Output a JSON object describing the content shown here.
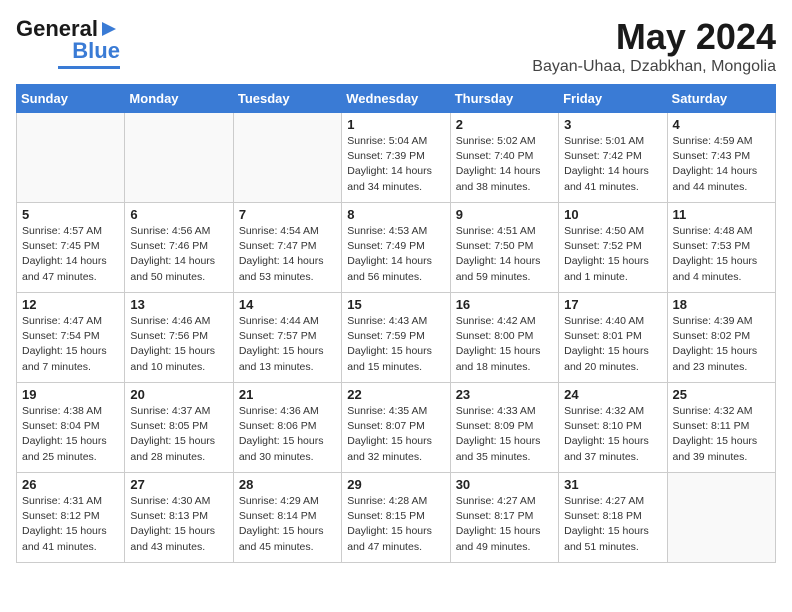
{
  "header": {
    "logo_general": "General",
    "logo_blue": "Blue",
    "month": "May 2024",
    "location": "Bayan-Uhaa, Dzabkhan, Mongolia"
  },
  "days_of_week": [
    "Sunday",
    "Monday",
    "Tuesday",
    "Wednesday",
    "Thursday",
    "Friday",
    "Saturday"
  ],
  "weeks": [
    [
      {
        "day": "",
        "info": ""
      },
      {
        "day": "",
        "info": ""
      },
      {
        "day": "",
        "info": ""
      },
      {
        "day": "1",
        "info": "Sunrise: 5:04 AM\nSunset: 7:39 PM\nDaylight: 14 hours\nand 34 minutes."
      },
      {
        "day": "2",
        "info": "Sunrise: 5:02 AM\nSunset: 7:40 PM\nDaylight: 14 hours\nand 38 minutes."
      },
      {
        "day": "3",
        "info": "Sunrise: 5:01 AM\nSunset: 7:42 PM\nDaylight: 14 hours\nand 41 minutes."
      },
      {
        "day": "4",
        "info": "Sunrise: 4:59 AM\nSunset: 7:43 PM\nDaylight: 14 hours\nand 44 minutes."
      }
    ],
    [
      {
        "day": "5",
        "info": "Sunrise: 4:57 AM\nSunset: 7:45 PM\nDaylight: 14 hours\nand 47 minutes."
      },
      {
        "day": "6",
        "info": "Sunrise: 4:56 AM\nSunset: 7:46 PM\nDaylight: 14 hours\nand 50 minutes."
      },
      {
        "day": "7",
        "info": "Sunrise: 4:54 AM\nSunset: 7:47 PM\nDaylight: 14 hours\nand 53 minutes."
      },
      {
        "day": "8",
        "info": "Sunrise: 4:53 AM\nSunset: 7:49 PM\nDaylight: 14 hours\nand 56 minutes."
      },
      {
        "day": "9",
        "info": "Sunrise: 4:51 AM\nSunset: 7:50 PM\nDaylight: 14 hours\nand 59 minutes."
      },
      {
        "day": "10",
        "info": "Sunrise: 4:50 AM\nSunset: 7:52 PM\nDaylight: 15 hours\nand 1 minute."
      },
      {
        "day": "11",
        "info": "Sunrise: 4:48 AM\nSunset: 7:53 PM\nDaylight: 15 hours\nand 4 minutes."
      }
    ],
    [
      {
        "day": "12",
        "info": "Sunrise: 4:47 AM\nSunset: 7:54 PM\nDaylight: 15 hours\nand 7 minutes."
      },
      {
        "day": "13",
        "info": "Sunrise: 4:46 AM\nSunset: 7:56 PM\nDaylight: 15 hours\nand 10 minutes."
      },
      {
        "day": "14",
        "info": "Sunrise: 4:44 AM\nSunset: 7:57 PM\nDaylight: 15 hours\nand 13 minutes."
      },
      {
        "day": "15",
        "info": "Sunrise: 4:43 AM\nSunset: 7:59 PM\nDaylight: 15 hours\nand 15 minutes."
      },
      {
        "day": "16",
        "info": "Sunrise: 4:42 AM\nSunset: 8:00 PM\nDaylight: 15 hours\nand 18 minutes."
      },
      {
        "day": "17",
        "info": "Sunrise: 4:40 AM\nSunset: 8:01 PM\nDaylight: 15 hours\nand 20 minutes."
      },
      {
        "day": "18",
        "info": "Sunrise: 4:39 AM\nSunset: 8:02 PM\nDaylight: 15 hours\nand 23 minutes."
      }
    ],
    [
      {
        "day": "19",
        "info": "Sunrise: 4:38 AM\nSunset: 8:04 PM\nDaylight: 15 hours\nand 25 minutes."
      },
      {
        "day": "20",
        "info": "Sunrise: 4:37 AM\nSunset: 8:05 PM\nDaylight: 15 hours\nand 28 minutes."
      },
      {
        "day": "21",
        "info": "Sunrise: 4:36 AM\nSunset: 8:06 PM\nDaylight: 15 hours\nand 30 minutes."
      },
      {
        "day": "22",
        "info": "Sunrise: 4:35 AM\nSunset: 8:07 PM\nDaylight: 15 hours\nand 32 minutes."
      },
      {
        "day": "23",
        "info": "Sunrise: 4:33 AM\nSunset: 8:09 PM\nDaylight: 15 hours\nand 35 minutes."
      },
      {
        "day": "24",
        "info": "Sunrise: 4:32 AM\nSunset: 8:10 PM\nDaylight: 15 hours\nand 37 minutes."
      },
      {
        "day": "25",
        "info": "Sunrise: 4:32 AM\nSunset: 8:11 PM\nDaylight: 15 hours\nand 39 minutes."
      }
    ],
    [
      {
        "day": "26",
        "info": "Sunrise: 4:31 AM\nSunset: 8:12 PM\nDaylight: 15 hours\nand 41 minutes."
      },
      {
        "day": "27",
        "info": "Sunrise: 4:30 AM\nSunset: 8:13 PM\nDaylight: 15 hours\nand 43 minutes."
      },
      {
        "day": "28",
        "info": "Sunrise: 4:29 AM\nSunset: 8:14 PM\nDaylight: 15 hours\nand 45 minutes."
      },
      {
        "day": "29",
        "info": "Sunrise: 4:28 AM\nSunset: 8:15 PM\nDaylight: 15 hours\nand 47 minutes."
      },
      {
        "day": "30",
        "info": "Sunrise: 4:27 AM\nSunset: 8:17 PM\nDaylight: 15 hours\nand 49 minutes."
      },
      {
        "day": "31",
        "info": "Sunrise: 4:27 AM\nSunset: 8:18 PM\nDaylight: 15 hours\nand 51 minutes."
      },
      {
        "day": "",
        "info": ""
      }
    ]
  ]
}
